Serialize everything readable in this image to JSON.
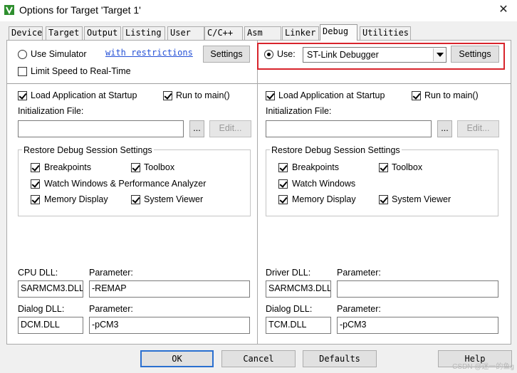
{
  "window": {
    "title": "Options for Target 'Target 1'",
    "close_glyph": "✕"
  },
  "tabs": [
    {
      "label": "Device"
    },
    {
      "label": "Target"
    },
    {
      "label": "Output"
    },
    {
      "label": "Listing"
    },
    {
      "label": "User"
    },
    {
      "label": "C/C++"
    },
    {
      "label": "Asm"
    },
    {
      "label": "Linker"
    },
    {
      "label": "Debug",
      "active": true
    },
    {
      "label": "Utilities"
    }
  ],
  "left": {
    "use_simulator_label": "Use Simulator",
    "restrictions_link": "with restrictions",
    "settings_label": "Settings",
    "limit_speed_label": "Limit Speed to Real-Time",
    "load_app_label": "Load Application at Startup",
    "run_to_main_label": "Run to main()",
    "init_file_label": "Initialization File:",
    "init_file_value": "",
    "browse_label": "...",
    "edit_label": "Edit...",
    "restore_group_label": "Restore Debug Session Settings",
    "breakpoints_label": "Breakpoints",
    "toolbox_label": "Toolbox",
    "watch_windows_label": "Watch Windows & Performance Analyzer",
    "memory_display_label": "Memory Display",
    "system_viewer_label": "System Viewer",
    "cpu_dll_label": "CPU DLL:",
    "cpu_dll_value": "SARMCM3.DLL",
    "cpu_param_label": "Parameter:",
    "cpu_param_value": "-REMAP",
    "dialog_dll_label": "Dialog DLL:",
    "dialog_dll_value": "DCM.DLL",
    "dialog_param_label": "Parameter:",
    "dialog_param_value": "-pCM3"
  },
  "right": {
    "use_label": "Use:",
    "debugger_value": "ST-Link Debugger",
    "settings_label": "Settings",
    "load_app_label": "Load Application at Startup",
    "run_to_main_label": "Run to main()",
    "init_file_label": "Initialization File:",
    "init_file_value": "",
    "browse_label": "...",
    "edit_label": "Edit...",
    "restore_group_label": "Restore Debug Session Settings",
    "breakpoints_label": "Breakpoints",
    "toolbox_label": "Toolbox",
    "watch_windows_label": "Watch Windows",
    "memory_display_label": "Memory Display",
    "system_viewer_label": "System Viewer",
    "driver_dll_label": "Driver DLL:",
    "driver_dll_value": "SARMCM3.DLL",
    "driver_param_label": "Parameter:",
    "driver_param_value": "",
    "dialog_dll_label": "Dialog DLL:",
    "dialog_dll_value": "TCM.DLL",
    "dialog_param_label": "Parameter:",
    "dialog_param_value": "-pCM3"
  },
  "footer": {
    "ok_label": "OK",
    "cancel_label": "Cancel",
    "defaults_label": "Defaults",
    "help_label": "Help"
  },
  "watermark": "CSDN @迷一的鱼g",
  "colors": {
    "highlight_box": "#d8242c",
    "link": "#2450d6"
  }
}
